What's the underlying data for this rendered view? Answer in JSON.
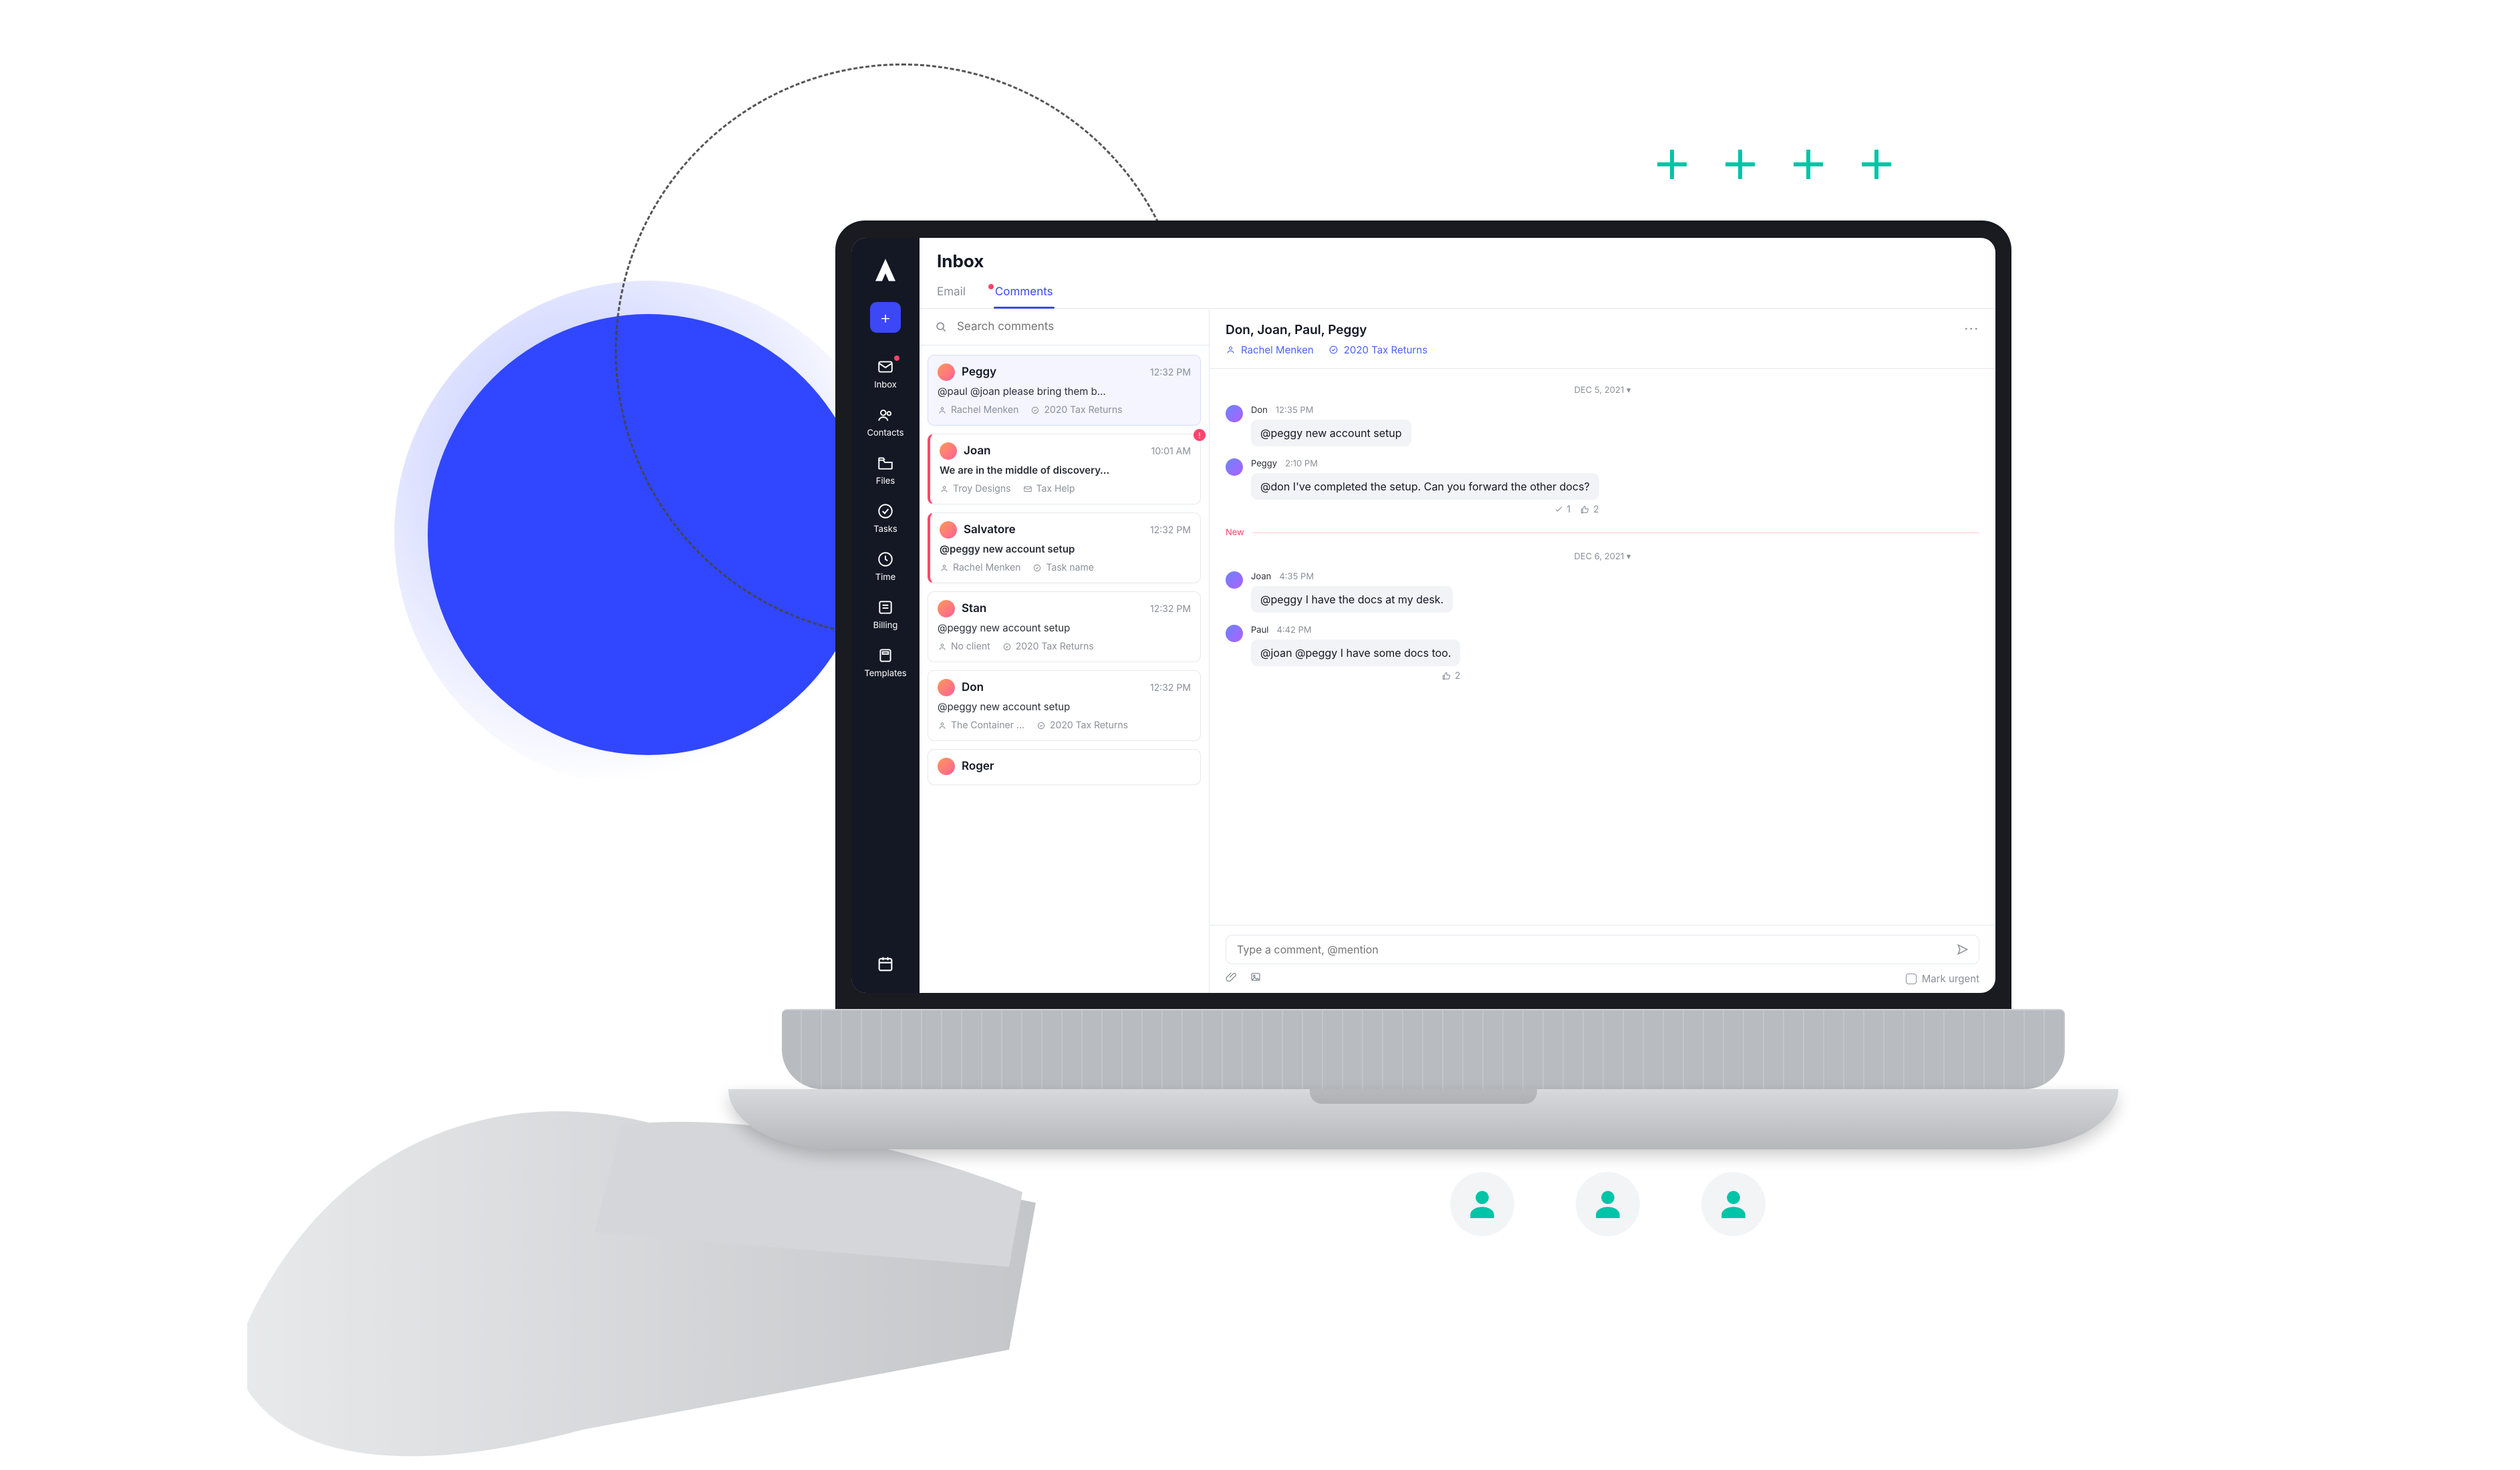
{
  "header": {
    "title": "Inbox"
  },
  "tabs": {
    "email": "Email",
    "comments": "Comments"
  },
  "search": {
    "placeholder": "Search comments"
  },
  "sidebar": {
    "items": [
      {
        "id": "inbox",
        "label": "Inbox"
      },
      {
        "id": "contacts",
        "label": "Contacts"
      },
      {
        "id": "files",
        "label": "Files"
      },
      {
        "id": "tasks",
        "label": "Tasks"
      },
      {
        "id": "time",
        "label": "Time"
      },
      {
        "id": "billing",
        "label": "Billing"
      },
      {
        "id": "templates",
        "label": "Templates"
      }
    ]
  },
  "list": [
    {
      "name": "Peggy",
      "time": "12:32 PM",
      "snippet": "@paul @joan please bring them b…",
      "client": "Rachel Menken",
      "task": "2020 Tax Returns",
      "selected": true
    },
    {
      "name": "Joan",
      "time": "10:01 AM",
      "snippet": "We are in the middle of discovery…",
      "client": "Troy Designs",
      "task": "Tax Help",
      "unread": true,
      "alert": true
    },
    {
      "name": "Salvatore",
      "time": "12:32 PM",
      "snippet": "@peggy new account setup",
      "client": "Rachel Menken",
      "task": "Task name",
      "unread": true
    },
    {
      "name": "Stan",
      "time": "12:32 PM",
      "snippet": "@peggy new account setup",
      "client": "No client",
      "task": "2020 Tax Returns"
    },
    {
      "name": "Don",
      "time": "12:32 PM",
      "snippet": "@peggy new account setup",
      "client": "The Container …",
      "task": "2020 Tax Returns"
    },
    {
      "name": "Roger",
      "time": "",
      "snippet": "",
      "client": "",
      "task": ""
    }
  ],
  "thread": {
    "participants": "Don, Joan, Paul, Peggy",
    "client_link": "Rachel Menken",
    "task_link": "2020 Tax Returns",
    "groups": [
      {
        "date": "DEC 5, 2021",
        "new": false,
        "messages": [
          {
            "name": "Don",
            "time": "12:35 PM",
            "body": "@peggy new account setup"
          },
          {
            "name": "Peggy",
            "time": "2:10 PM",
            "body": "@don I've completed the setup. Can you forward the other docs?",
            "check": 1,
            "likes": 2
          }
        ]
      },
      {
        "date": "DEC 6, 2021",
        "new": true,
        "messages": [
          {
            "name": "Joan",
            "time": "4:35 PM",
            "body": "@peggy I have the docs at my desk."
          },
          {
            "name": "Paul",
            "time": "4:42 PM",
            "body": "@joan @peggy I have some docs too.",
            "likes": 2
          }
        ]
      }
    ]
  },
  "composer": {
    "placeholder": "Type a comment, @mention",
    "urgent_label": "Mark urgent"
  },
  "divider": {
    "new": "New"
  }
}
